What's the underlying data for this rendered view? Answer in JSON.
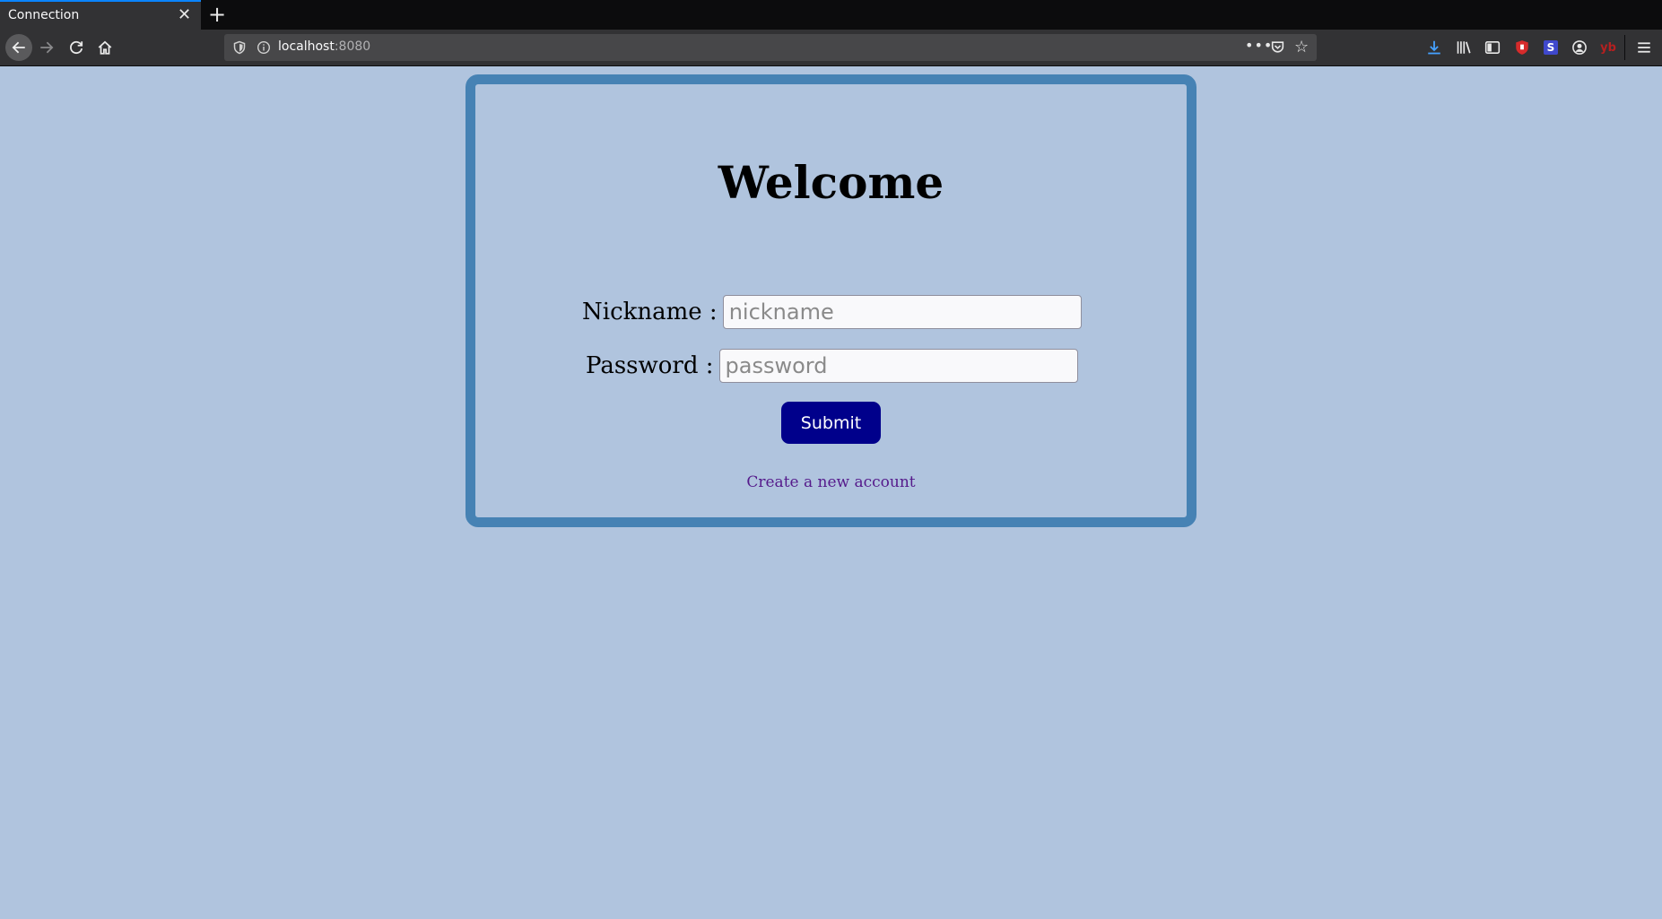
{
  "browser": {
    "tab_title": "Connection",
    "url_host": "localhost",
    "url_port": ":8080",
    "colors": {
      "tab_accent": "#0a84ff",
      "toolbar": "#323234",
      "download_icon": "#45a1ff",
      "ublock_icon": "#d62b2b",
      "sync_icon": "#3f48cc"
    },
    "toolbar_icons": [
      "download-icon",
      "library-icon",
      "sidebar-icon",
      "ublock-icon",
      "extension-s-icon",
      "account-icon",
      "yb-extension-icon",
      "menu-icon"
    ]
  },
  "page": {
    "background": "#b0c4de",
    "card_border": "#4682b4",
    "heading": "Welcome",
    "nickname_label": "Nickname :",
    "nickname_placeholder": "nickname",
    "password_label": "Password :",
    "password_placeholder": "password",
    "submit_label": "Submit",
    "submit_color": "#00008b",
    "create_account_link": "Create a new account",
    "yb_label": "yb"
  }
}
